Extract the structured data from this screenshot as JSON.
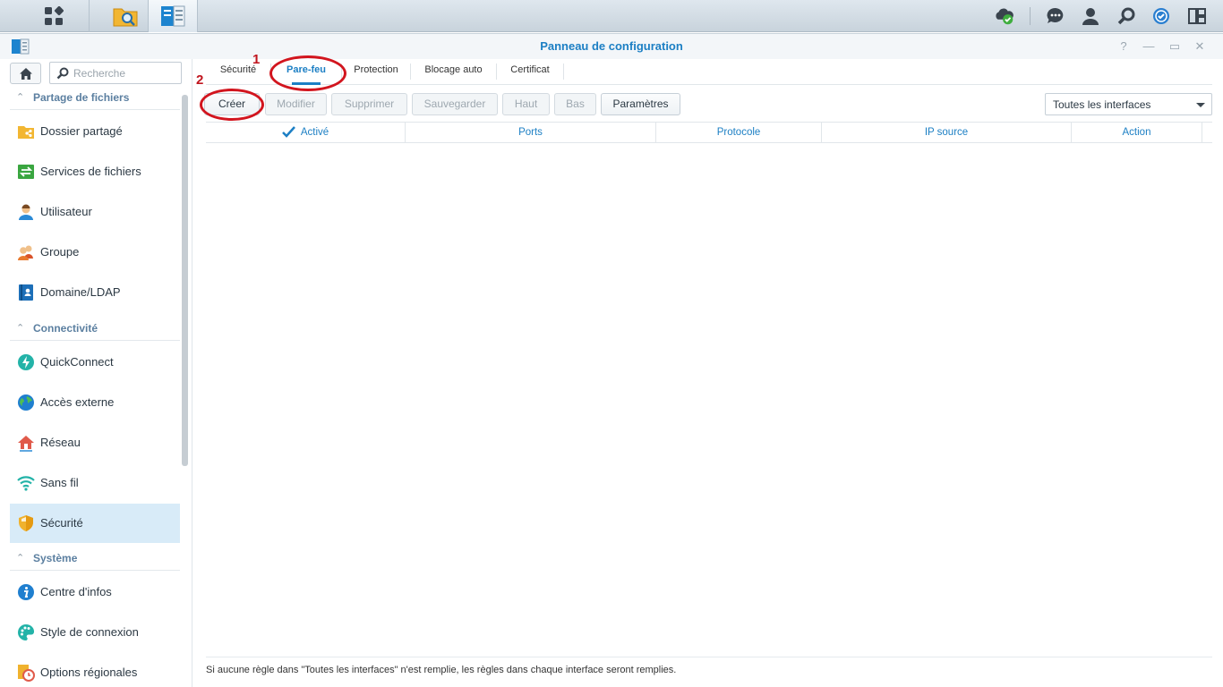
{
  "taskbar": {
    "apps": [
      {
        "name": "main-menu",
        "icon": "grid-icon"
      },
      {
        "name": "file-station",
        "icon": "folder-search-icon"
      },
      {
        "name": "control-panel",
        "icon": "control-panel-icon"
      }
    ],
    "tray": [
      "cloud-sync-icon",
      "chat-icon",
      "user-icon",
      "search-icon",
      "widget-icon",
      "layout-icon"
    ]
  },
  "window": {
    "title": "Panneau de configuration",
    "controls": {
      "help": "?",
      "minimize": "—",
      "restore": "▭",
      "close": "✕"
    }
  },
  "sidebar": {
    "search_placeholder": "Recherche",
    "sections": [
      {
        "label": "Partage de fichiers",
        "items": [
          {
            "label": "Dossier partagé",
            "icon": "shared-folder-icon"
          },
          {
            "label": "Services de fichiers",
            "icon": "file-services-icon"
          },
          {
            "label": "Utilisateur",
            "icon": "user-icon"
          },
          {
            "label": "Groupe",
            "icon": "group-icon"
          },
          {
            "label": "Domaine/LDAP",
            "icon": "domain-icon"
          }
        ]
      },
      {
        "label": "Connectivité",
        "items": [
          {
            "label": "QuickConnect",
            "icon": "quickconnect-icon"
          },
          {
            "label": "Accès externe",
            "icon": "globe-icon"
          },
          {
            "label": "Réseau",
            "icon": "network-icon"
          },
          {
            "label": "Sans fil",
            "icon": "wifi-icon"
          },
          {
            "label": "Sécurité",
            "icon": "shield-icon",
            "selected": true
          }
        ]
      },
      {
        "label": "Système",
        "items": [
          {
            "label": "Centre d'infos",
            "icon": "info-icon"
          },
          {
            "label": "Style de connexion",
            "icon": "palette-icon"
          },
          {
            "label": "Options régionales",
            "icon": "clock-icon"
          }
        ]
      }
    ]
  },
  "main": {
    "tabs": [
      {
        "label": "Sécurité"
      },
      {
        "label": "Pare-feu",
        "active": true
      },
      {
        "label": "Protection"
      },
      {
        "label": "Blocage auto"
      },
      {
        "label": "Certificat"
      }
    ],
    "toolbar": {
      "create": "Créer",
      "modify": "Modifier",
      "delete": "Supprimer",
      "save": "Sauvegarder",
      "up": "Haut",
      "down": "Bas",
      "settings": "Paramètres"
    },
    "interface_select": "Toutes les interfaces",
    "columns": [
      "Activé",
      "Ports",
      "Protocole",
      "IP source",
      "Action"
    ],
    "footer_note": "Si aucune règle dans \"Toutes les interfaces\" n'est remplie, les règles dans chaque interface seront remplies."
  },
  "annotations": {
    "step1": "1",
    "step2": "2"
  },
  "colors": {
    "accent": "#1c7fc4",
    "annotation": "#d2151e",
    "selected_bg": "#d8ebf8"
  }
}
